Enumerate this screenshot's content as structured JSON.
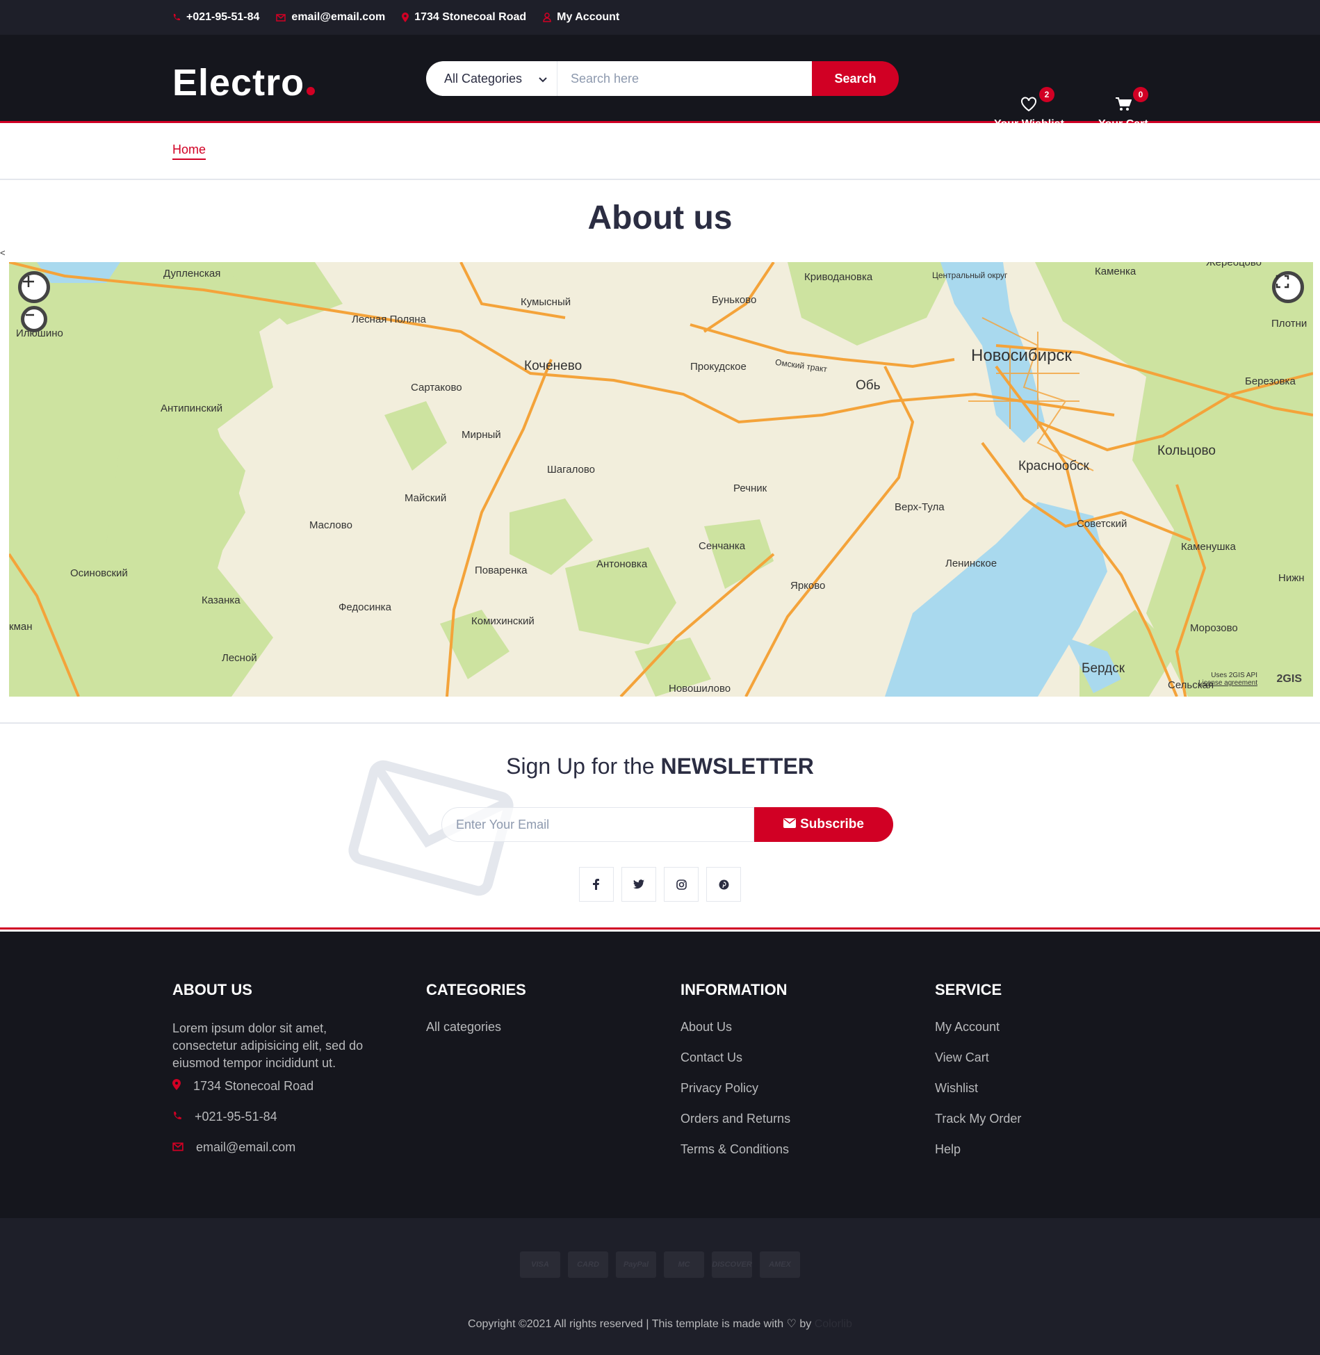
{
  "topbar": {
    "phone": "+021-95-51-84",
    "email": "email@email.com",
    "address": "1734 Stonecoal Road",
    "account": "My Account"
  },
  "header": {
    "logo": "Electro",
    "category_select": "All Categories",
    "search_placeholder": "Search here",
    "search_button": "Search",
    "wishlist_label": "Your Wishlist",
    "wishlist_count": "2",
    "cart_label": "Your Cart",
    "cart_count": "0"
  },
  "breadcrumb": {
    "home": "Home"
  },
  "page": {
    "title": "About us",
    "stray": "<"
  },
  "map": {
    "labels": {
      "dupl": "Дупленская",
      "ilyush": "Илюшино",
      "lesnaya": "Лесная Поляна",
      "kumysh": "Кумысный",
      "kochen": "Коченево",
      "bunk": "Буньково",
      "krivod": "Криводановка",
      "centr": "Центральный округ",
      "kamenka": "Каменка",
      "zherdo": "Жеребцово",
      "plotn": "Плотни",
      "antip": "Антипинский",
      "sartak": "Сартаково",
      "prokud": "Прокудское",
      "omsk": "Омский тракт",
      "ob": "Обь",
      "novosib": "Новосибирск",
      "berez": "Березовка",
      "mirny": "Мирный",
      "shagal": "Шагалово",
      "koltsovo": "Кольцово",
      "krasnoob": "Краснообск",
      "rechnik": "Речник",
      "maysk": "Майский",
      "verkh": "Верх-Тула",
      "maslovo": "Маслово",
      "sovet": "Советский",
      "senchanka": "Сенчанка",
      "kamenush": "Каменушка",
      "osinov": "Осиновский",
      "povarenka": "Поваренка",
      "antonovka": "Антоновка",
      "leninsk": "Ленинское",
      "nizhn": "Нижн",
      "kazanka": "Казанка",
      "fedos": "Федосинка",
      "yarkovo": "Ярково",
      "kman": "кман",
      "komikh": "Комихинский",
      "morozovo": "Морозово",
      "lesnoy": "Лесной",
      "berdsk": "Бердск",
      "novoshil": "Новошилово",
      "selsk": "Сельская"
    },
    "attribution": "Uses 2GIS API",
    "license": "License agreement",
    "provider": "2GIS",
    "colors": {
      "land": "#f2eedc",
      "forest": "#cde3a0",
      "water": "#a9d9ee",
      "road": "#f4a33a"
    }
  },
  "newsletter": {
    "title_prefix": "Sign Up for the",
    "title_strong": "NEWSLETTER",
    "email_placeholder": "Enter Your Email",
    "subscribe_button": "Subscribe",
    "socials": [
      "facebook-icon",
      "twitter-icon",
      "instagram-icon",
      "pinterest-icon"
    ]
  },
  "footer": {
    "about": {
      "title": "ABOUT US",
      "text": "Lorem ipsum dolor sit amet, consectetur adipisicing elit, sed do eiusmod tempor incididunt ut.",
      "address": "1734 Stonecoal Road",
      "phone": "+021-95-51-84",
      "email": "email@email.com"
    },
    "categories": {
      "title": "CATEGORIES",
      "items": [
        "All categories"
      ]
    },
    "information": {
      "title": "INFORMATION",
      "items": [
        "About Us",
        "Contact Us",
        "Privacy Policy",
        "Orders and Returns",
        "Terms & Conditions"
      ]
    },
    "service": {
      "title": "SERVICE",
      "items": [
        "My Account",
        "View Cart",
        "Wishlist",
        "Track My Order",
        "Help"
      ]
    },
    "payment_cards": [
      "VISA",
      "CARD",
      "PayPal",
      "MC",
      "DISCOVER",
      "AMEX"
    ],
    "copyright": "Copyright ©2021 All rights reserved | This template is made with ♡ by",
    "brand": "Colorlib"
  },
  "colors": {
    "accent": "#d10024",
    "dark": "#15161d",
    "topbar": "#1e1f29"
  }
}
